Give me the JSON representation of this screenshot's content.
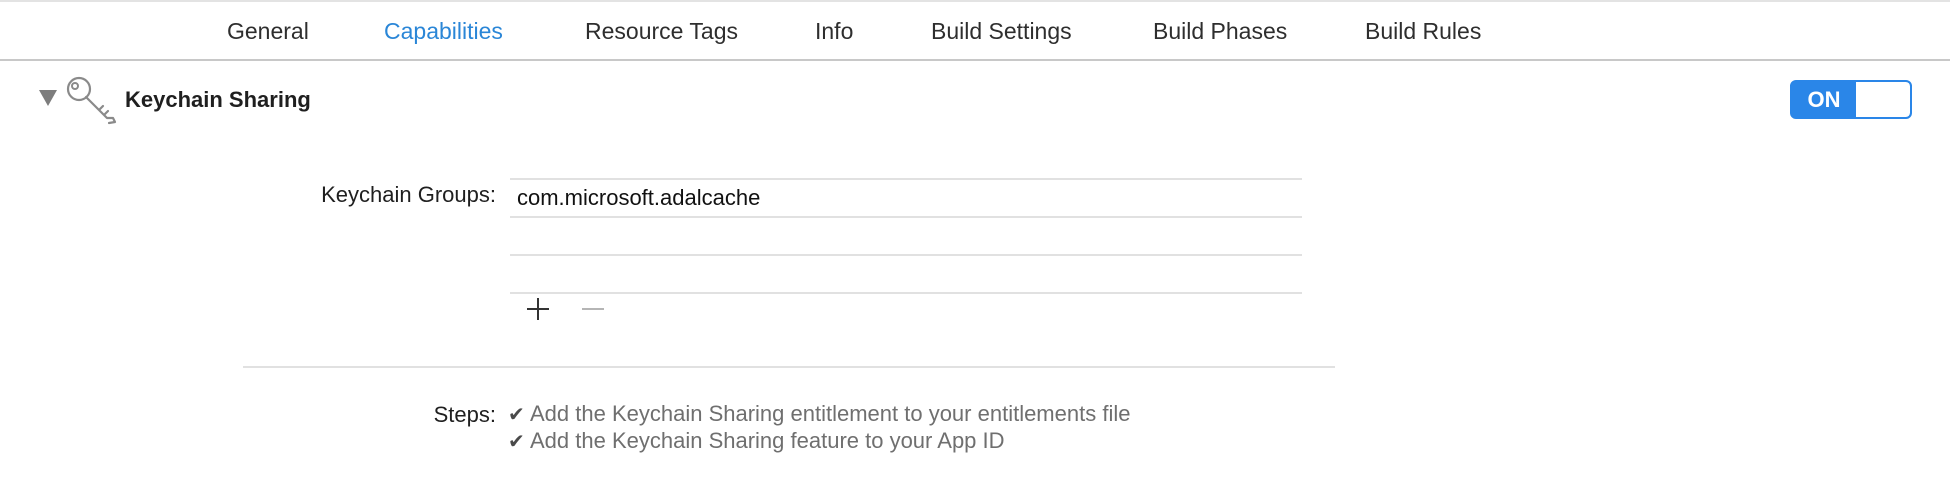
{
  "tabs": [
    {
      "label": "General"
    },
    {
      "label": "Capabilities",
      "active": true
    },
    {
      "label": "Resource Tags"
    },
    {
      "label": "Info"
    },
    {
      "label": "Build Settings"
    },
    {
      "label": "Build Phases"
    },
    {
      "label": "Build Rules"
    }
  ],
  "capability": {
    "title": "Keychain Sharing",
    "icon": "key-icon",
    "toggle_label": "ON",
    "toggle_state": "on"
  },
  "keychain_groups": {
    "label": "Keychain Groups:",
    "rows": [
      "com.microsoft.adalcache",
      "",
      ""
    ],
    "add_icon": "plus-icon",
    "remove_icon": "minus-icon"
  },
  "steps": {
    "label": "Steps:",
    "check_glyph": "✔",
    "items": [
      "Add the Keychain Sharing entitlement to your entitlements file",
      "Add the Keychain Sharing feature to your App ID"
    ]
  },
  "colors": {
    "accent": "#2a86d7",
    "toggle": "#2a86e8"
  }
}
